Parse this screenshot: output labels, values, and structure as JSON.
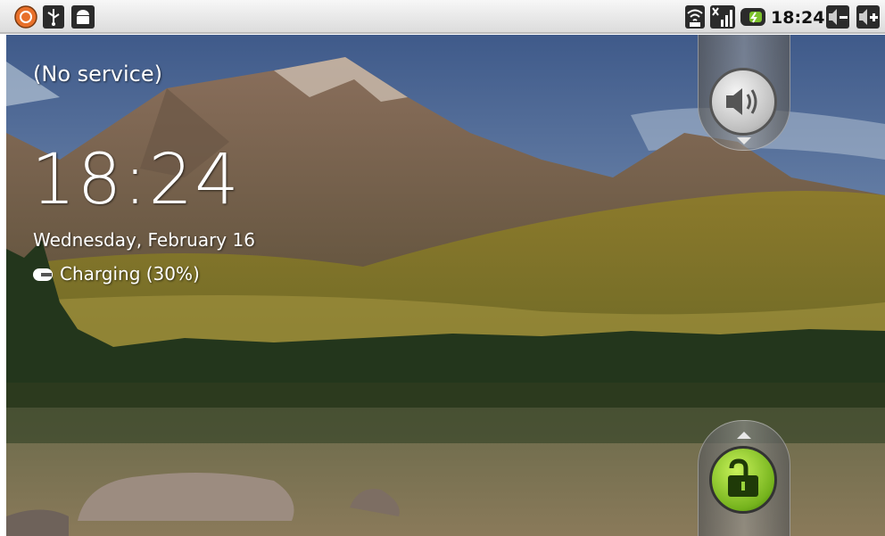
{
  "status_bar": {
    "time": "18:24",
    "left_icons": [
      "notification-app-icon",
      "usb-icon",
      "android-debug-icon"
    ],
    "right_icons": [
      "wifi-icon",
      "no-signal-icon",
      "battery-charging-icon",
      "volume-down-icon",
      "volume-up-icon"
    ]
  },
  "lockscreen": {
    "carrier": "(No service)",
    "clock": "18:24",
    "date": "Wednesday, February 16",
    "charging": "Charging (30%)",
    "sound_toggle_icon": "speaker-icon",
    "unlock_icon": "unlock-padlock-icon"
  },
  "colors": {
    "unlock_green": "#74b21c",
    "status_bar_bg": "#e6e6e6"
  }
}
